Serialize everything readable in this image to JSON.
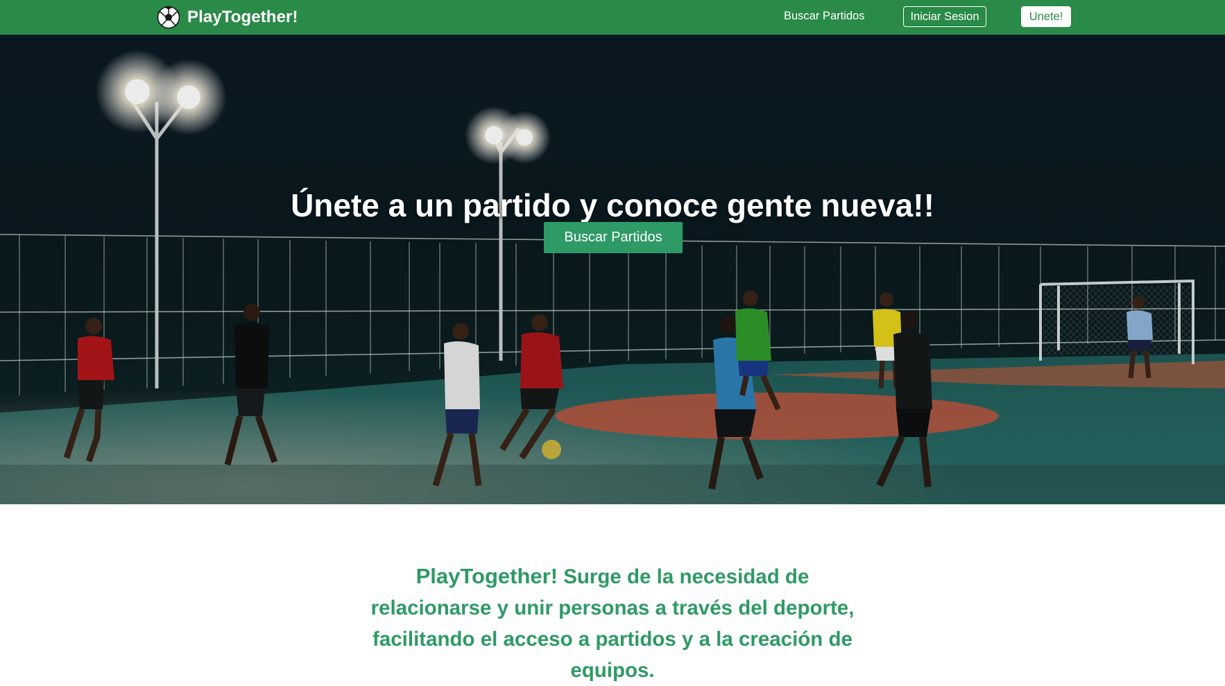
{
  "navbar": {
    "brand_text": "PlayTogether!",
    "brand_icon": "soccer-ball-icon",
    "links": {
      "search_label": "Buscar Partidos"
    },
    "login_label": "Iniciar Sesion",
    "signup_label": "Unete!"
  },
  "hero": {
    "title": "Únete a un partido y conoce gente nueva!!",
    "button_label": "Buscar Partidos"
  },
  "about": {
    "brand": "PlayTogether!",
    "text": " Surge de la necesidad de relacionarse y unir personas a través del deporte, facilitando el acceso a partidos y a la creación de equipos."
  },
  "colors": {
    "primary_green": "#2a8a48",
    "accent_green": "#2e9a66",
    "text_white": "#ffffff"
  }
}
